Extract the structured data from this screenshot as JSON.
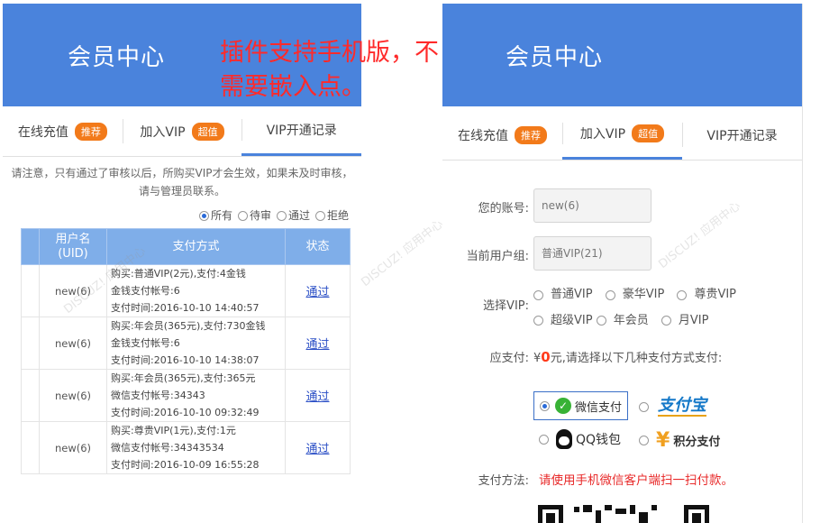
{
  "overlay": {
    "line1": "插件支持手机版，不",
    "line2": "需要嵌入点。"
  },
  "left": {
    "header_title": "会员中心",
    "tabs": [
      {
        "label": "在线充值",
        "badge": "推荐"
      },
      {
        "label": "加入VIP",
        "badge": "超值"
      },
      {
        "label": "VIP开通记录",
        "badge": ""
      }
    ],
    "notice_line1": "请注意，只有通过了审核以后，所购买VIP才会生效，如果未及时审核，",
    "notice_line2": "请与管理员联系。",
    "filters": [
      "所有",
      "待审",
      "通过",
      "拒绝"
    ],
    "table": {
      "headers": [
        "用户名",
        "(UID)",
        "支付方式",
        "状态"
      ],
      "rows": [
        {
          "uid": "new(6)",
          "l1": "购买:普通VIP(2元),支付:4金钱",
          "l2": "金钱支付帐号:6",
          "l3": "支付时间:2016-10-10 14:40:57",
          "status": "通过"
        },
        {
          "uid": "new(6)",
          "l1": "购买:年会员(365元),支付:730金钱",
          "l2": "金钱支付帐号:6",
          "l3": "支付时间:2016-10-10 14:38:07",
          "status": "通过"
        },
        {
          "uid": "new(6)",
          "l1": "购买:年会员(365元),支付:365元",
          "l2": "微信支付帐号:34343",
          "l3": "支付时间:2016-10-10 09:32:49",
          "status": "通过"
        },
        {
          "uid": "new(6)",
          "l1": "购买:尊贵VIP(1元),支付:1元",
          "l2": "微信支付帐号:34343534",
          "l3": "支付时间:2016-10-09 16:55:28",
          "status": "通过"
        }
      ]
    }
  },
  "right": {
    "header_title": "会员中心",
    "tabs": [
      {
        "label": "在线充值",
        "badge": "推荐"
      },
      {
        "label": "加入VIP",
        "badge": "超值"
      },
      {
        "label": "VIP开通记录",
        "badge": ""
      }
    ],
    "account_label": "您的账号:",
    "account_value": "new(6)",
    "group_label": "当前用户组:",
    "group_value": "普通VIP(21)",
    "vip_label": "选择VIP:",
    "vip_options": [
      "普通VIP",
      "豪华VIP",
      "尊贵VIP",
      "超级VIP",
      "年会员",
      "月VIP"
    ],
    "pay_label": "应支付:",
    "pay_currency": "¥",
    "pay_amount": "0",
    "pay_suffix": "元,请选择以下几种支付方式支付:",
    "methods": {
      "wechat": "微信支付",
      "alipay": "支付宝",
      "qq": "QQ钱包",
      "points": "积分支付"
    },
    "method_label": "支付方法:",
    "method_text": "请使用手机微信客户端扫一扫付款。"
  },
  "colors": {
    "header_blue": "#4a83dc",
    "badge_orange": "#f27a1a",
    "overlay_red": "#ff2a2a",
    "link_blue": "#2b4fc6"
  }
}
